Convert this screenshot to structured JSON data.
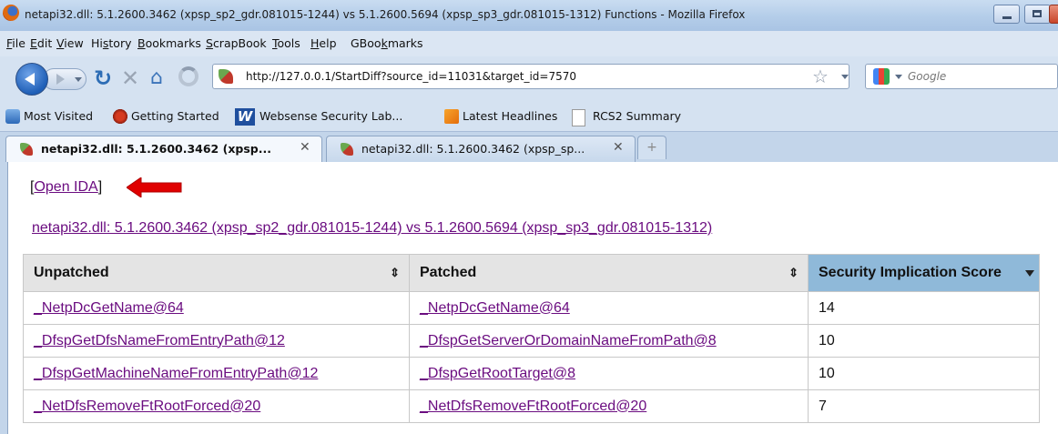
{
  "window": {
    "title": "netapi32.dll: 5.1.2600.3462 (xpsp_sp2_gdr.081015-1244) vs 5.1.2600.5694 (xpsp_sp3_gdr.081015-1312) Functions - Mozilla Firefox"
  },
  "menu": [
    {
      "pre": "",
      "u": "F",
      "post": "ile"
    },
    {
      "pre": "",
      "u": "E",
      "post": "dit"
    },
    {
      "pre": "",
      "u": "V",
      "post": "iew"
    },
    {
      "pre": "Hi",
      "u": "s",
      "post": "tory"
    },
    {
      "pre": "",
      "u": "B",
      "post": "ookmarks"
    },
    {
      "pre": "",
      "u": "S",
      "post": "crapBook"
    },
    {
      "pre": "",
      "u": "T",
      "post": "ools"
    },
    {
      "pre": "",
      "u": "H",
      "post": "elp"
    },
    {
      "pre": "GBoo",
      "u": "k",
      "post": "marks"
    }
  ],
  "nav": {
    "url": "http://127.0.0.1/StartDiff?source_id=11031&target_id=7570",
    "search_placeholder": "Google",
    "icons": [
      "back-icon",
      "forward-icon",
      "reload-icon",
      "stop-icon",
      "home-icon",
      "throbber-icon",
      "bookmark-star-icon",
      "google-icon"
    ]
  },
  "bookmarks": [
    {
      "label": "Most Visited",
      "icon": "most-visited-icon"
    },
    {
      "label": "Getting Started",
      "icon": "getting-started-icon"
    },
    {
      "label": "Websense Security Lab...",
      "icon": "websense-icon"
    },
    {
      "label": "Latest Headlines",
      "icon": "rss-icon"
    },
    {
      "label": "RCS2 Summary",
      "icon": "page-icon"
    }
  ],
  "tabs": [
    {
      "label": "netapi32.dll: 5.1.2600.3462 (xpsp...",
      "active": true
    },
    {
      "label": "netapi32.dll: 5.1.2600.3462 (xpsp_sp...",
      "active": false
    }
  ],
  "page": {
    "open_ida_prefix": "[",
    "open_ida_label": "Open IDA",
    "open_ida_suffix": "]",
    "diff_title": "netapi32.dll: 5.1.2600.3462 (xpsp_sp2_gdr.081015-1244) vs 5.1.2600.5694 (xpsp_sp3_gdr.081015-1312)",
    "table": {
      "headers": [
        "Unpatched",
        "Patched",
        "Security Implication Score"
      ],
      "rows": [
        {
          "unpatched": "_NetpDcGetName@64",
          "patched": "_NetpDcGetName@64",
          "score": "14"
        },
        {
          "unpatched": "_DfspGetDfsNameFromEntryPath@12",
          "patched": "_DfspGetServerOrDomainNameFromPath@8",
          "score": "10"
        },
        {
          "unpatched": "_DfspGetMachineNameFromEntryPath@12",
          "patched": "_DfspGetRootTarget@8",
          "score": "10"
        },
        {
          "unpatched": "_NetDfsRemoveFtRootForced@20",
          "patched": "_NetDfsRemoveFtRootForced@20",
          "score": "7"
        }
      ]
    }
  },
  "colors": {
    "link_visited": "#6b0d80",
    "sorted_header": "#8fb9d9",
    "arrow": "#e00000"
  }
}
